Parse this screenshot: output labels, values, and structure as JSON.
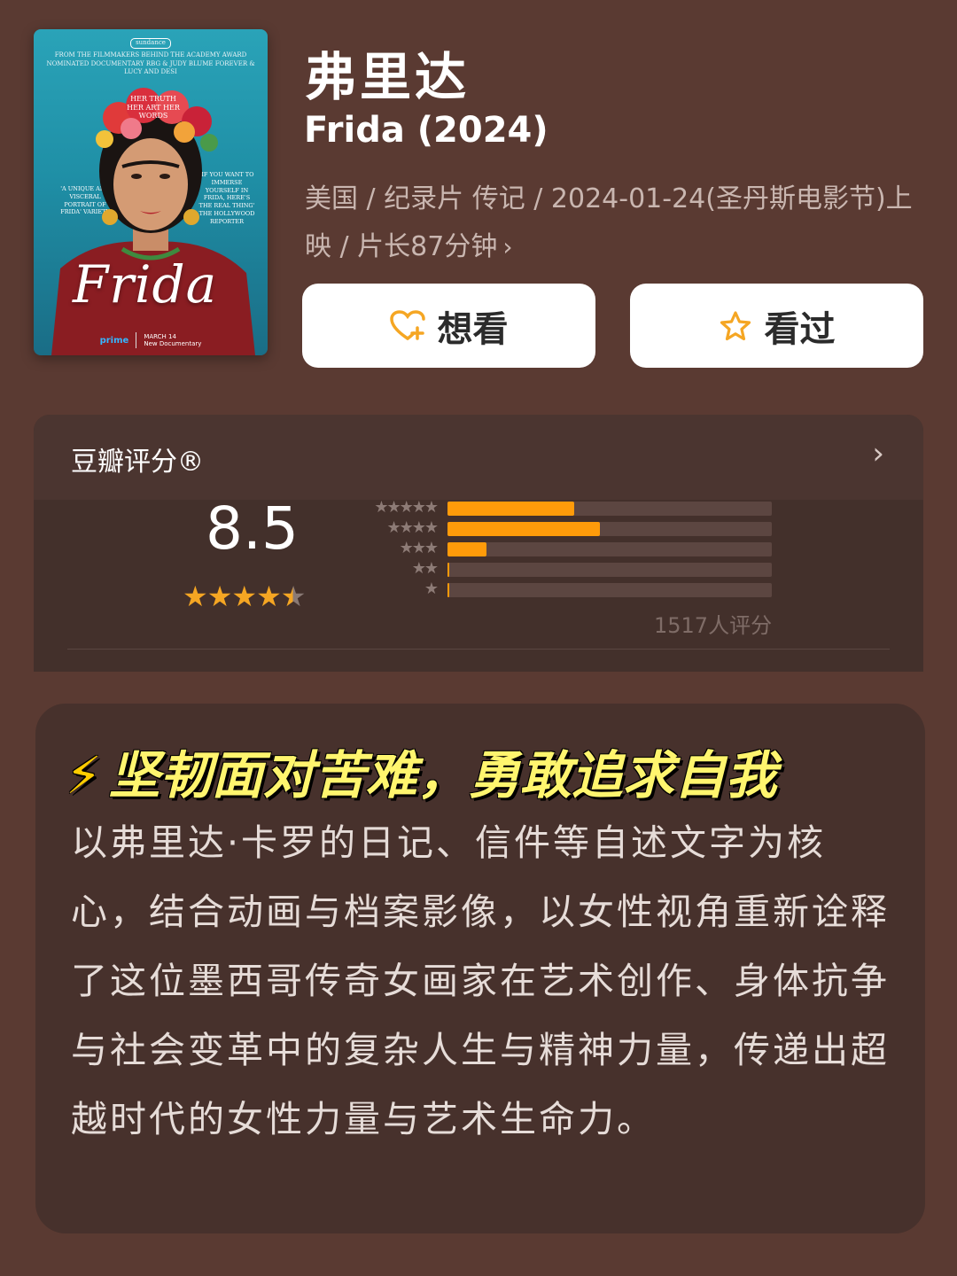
{
  "poster": {
    "credit_line": "FROM THE FILMMAKERS BEHIND THE ACADEMY AWARD NOMINATED DOCUMENTARY RBG & JUDY BLUME FOREVER & LUCY AND DESI",
    "festival": "sundance",
    "hair_text": "HER TRUTH HER ART HER WORDS",
    "quote_left": "'A UNIQUE AND VISCERAL PORTRAIT OF FRIDA' VARIETY",
    "quote_right": "'IF YOU WANT TO IMMERSE YOURSELF IN FRIDA, HERE'S THE REAL THING' THE HOLLYWOOD REPORTER",
    "script_title": "Frida",
    "prime": "prime",
    "release": "MARCH 14",
    "release_sub": "New Documentary"
  },
  "movie": {
    "title_cn": "弗里达",
    "title_en": "Frida (2024)",
    "meta": "美国 / 纪录片 传记 / 2024-01-24(圣丹斯电影节)上映 / 片长87分钟",
    "meta_chevron": "›"
  },
  "actions": {
    "want_label": "想看",
    "seen_label": "看过"
  },
  "rating": {
    "label": "豆瓣评分®",
    "chevron": "›",
    "score": "8.5",
    "stars_value": 4.5,
    "votes": "1517人评分",
    "distribution": [
      {
        "stars": "★★★★★",
        "fraction": 0.39
      },
      {
        "stars": "★★★★",
        "fraction": 0.47
      },
      {
        "stars": "★★★",
        "fraction": 0.12
      },
      {
        "stars": "★★",
        "fraction": 0.005
      },
      {
        "stars": "★",
        "fraction": 0.005
      }
    ]
  },
  "summary": {
    "bolt": "⚡",
    "headline": "坚韧面对苦难，勇敢追求自我",
    "body": "以弗里达·卡罗的日记、信件等自述文字为核心，结合动画与档案影像，以女性视角重新诠释了这位墨西哥传奇女画家在艺术创作、身体抗争与社会变革中的复杂人生与精神力量，传递出超越时代的女性力量与艺术生命力。"
  },
  "colors": {
    "background": "#5a3a32",
    "accent": "#ff9b0a",
    "headline": "#fff56e"
  }
}
